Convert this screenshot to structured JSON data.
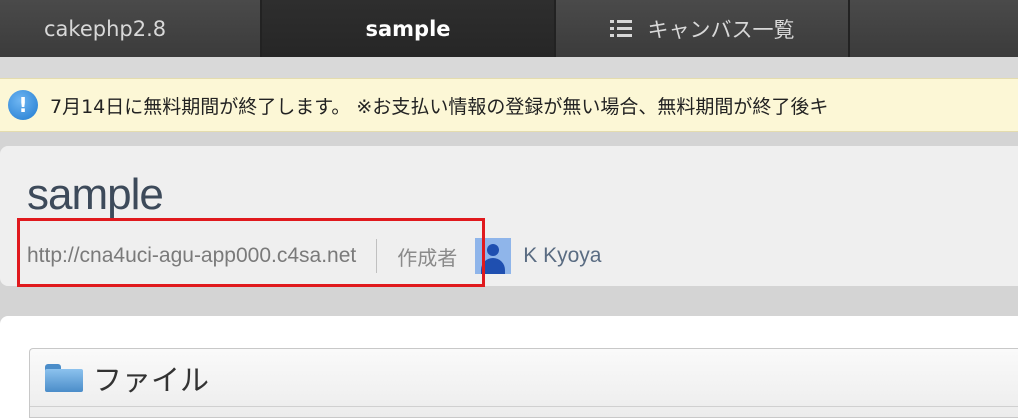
{
  "tabs": {
    "project": "cakephp2.8",
    "current": "sample",
    "canvas_list": "キャンバス一覧"
  },
  "notice": {
    "icon": "info-icon",
    "text": "7月14日に無料期間が終了します。 ※お支払い情報の登録が無い場合、無料期間が終了後キ"
  },
  "app": {
    "title": "sample",
    "url": "http://cna4uci-agu-app000.c4sa.net",
    "author_label": "作成者",
    "author_name": "K Kyoya"
  },
  "files": {
    "title": "ファイル",
    "icon": "folder-icon"
  },
  "colors": {
    "highlight": "#e0191d",
    "notice_bg": "#fcf7d6",
    "info_blue": "#1f7ad0"
  }
}
